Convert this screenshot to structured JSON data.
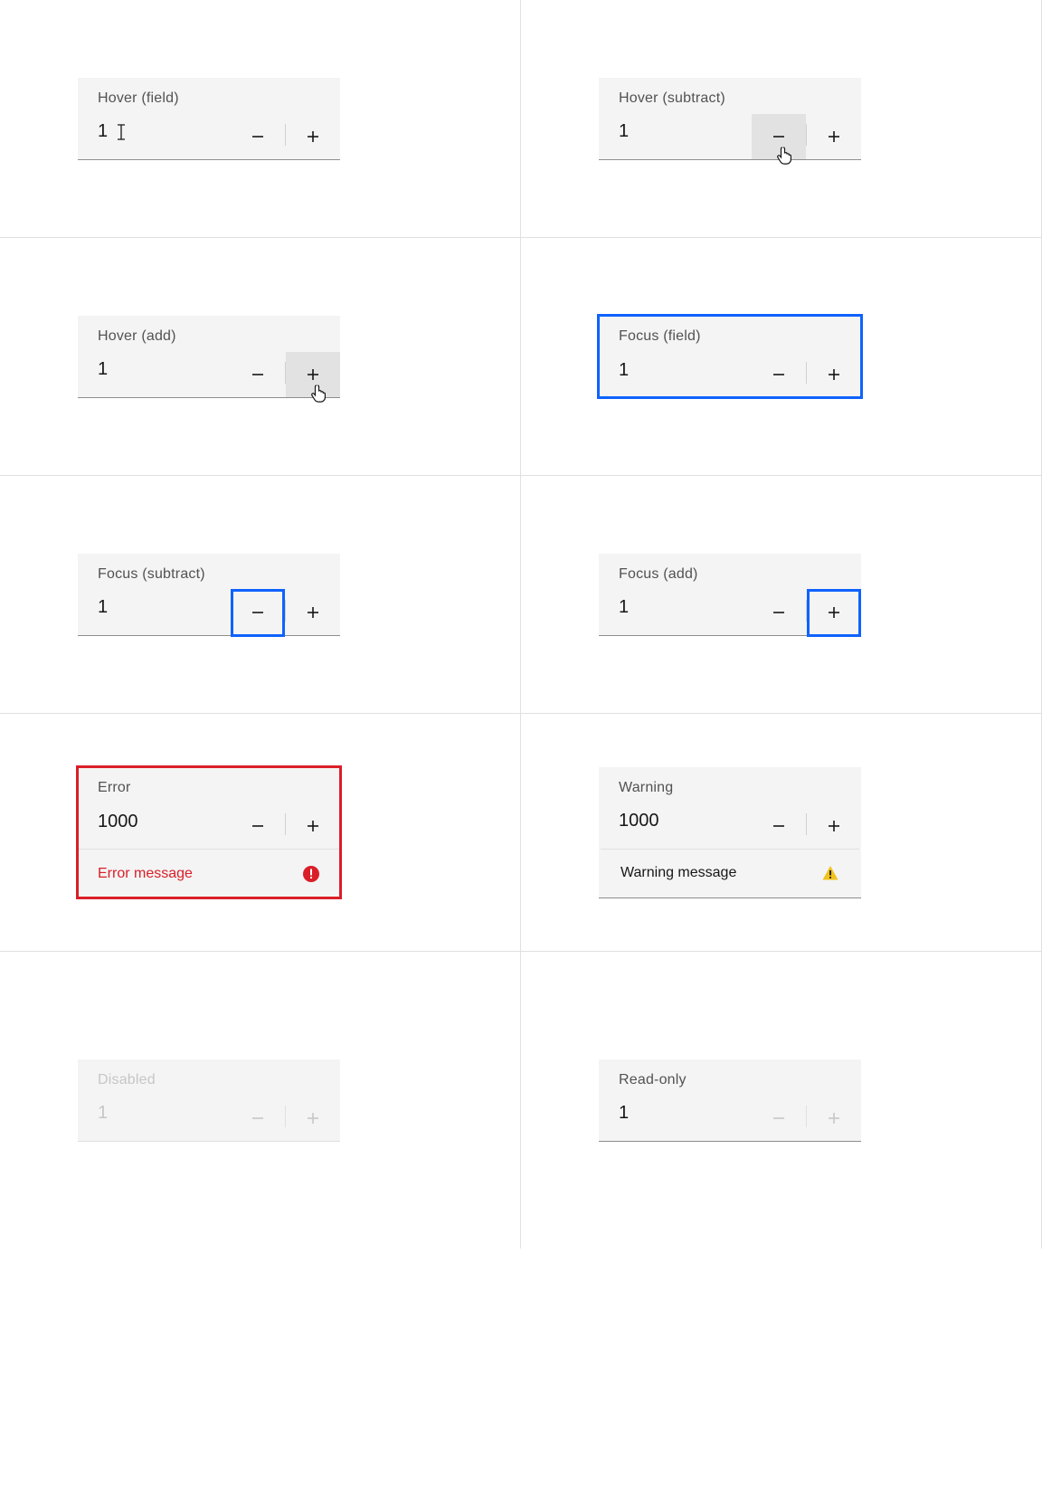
{
  "colors": {
    "focus": "#0f62fe",
    "error": "#da1e28",
    "warning": "#f1c21b"
  },
  "states": {
    "hover_field": {
      "label": "Hover (field)",
      "value": "1"
    },
    "hover_subtract": {
      "label": "Hover (subtract)",
      "value": "1"
    },
    "hover_add": {
      "label": "Hover (add)",
      "value": "1"
    },
    "focus_field": {
      "label": "Focus (field)",
      "value": "1"
    },
    "focus_subtract": {
      "label": "Focus (subtract)",
      "value": "1"
    },
    "focus_add": {
      "label": "Focus (add)",
      "value": "1"
    },
    "error": {
      "label": "Error",
      "value": "1000",
      "message": "Error message"
    },
    "warning": {
      "label": "Warning",
      "value": "1000",
      "message": "Warning message"
    },
    "disabled": {
      "label": "Disabled",
      "value": "1"
    },
    "readonly": {
      "label": "Read-only",
      "value": "1"
    }
  }
}
